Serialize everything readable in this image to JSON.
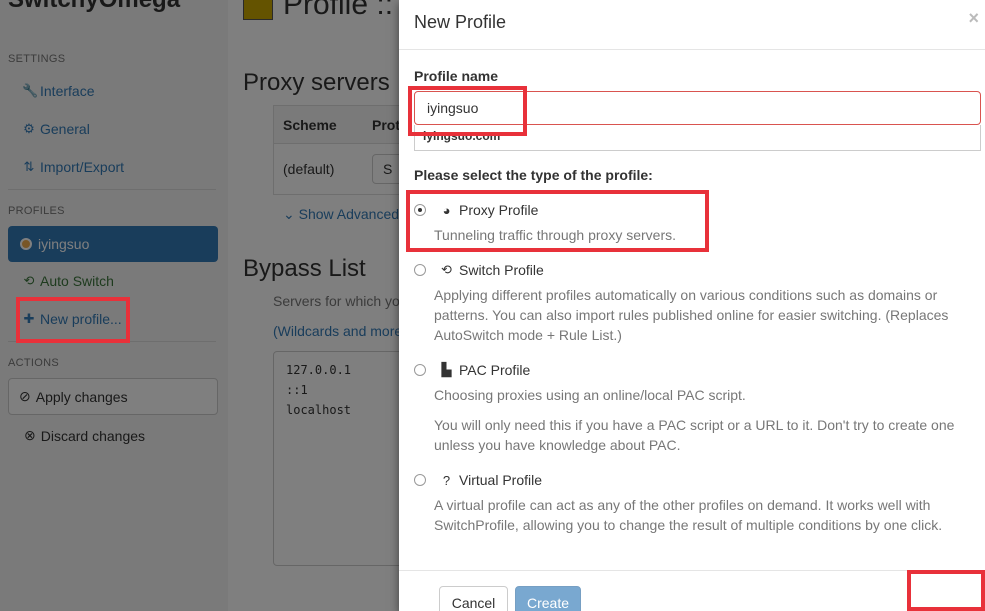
{
  "sidebar": {
    "brand": "SwitchyOmega",
    "settings_header": "SETTINGS",
    "settings_items": [
      {
        "label": "Interface",
        "icon": "wrench-icon"
      },
      {
        "label": "General",
        "icon": "gear-icon"
      },
      {
        "label": "Import/Export",
        "icon": "import-export-icon"
      }
    ],
    "profiles_header": "PROFILES",
    "profiles": [
      {
        "label": "iyingsuo",
        "icon": "globe-icon",
        "active": true
      },
      {
        "label": "Auto Switch",
        "icon": "retweet-icon"
      }
    ],
    "new_profile_label": "New profile...",
    "actions_header": "ACTIONS",
    "apply_label": "Apply changes",
    "discard_label": "Discard changes"
  },
  "main": {
    "profile_title": "Profile ::",
    "proxy_servers_heading": "Proxy servers",
    "table": {
      "headers": [
        "Scheme",
        "Prot"
      ],
      "rows": [
        [
          "(default)",
          "S"
        ]
      ]
    },
    "show_advanced": "Show Advanced",
    "bypass_heading": "Bypass List",
    "bypass_desc": "Servers for which yo",
    "bypass_link": "(Wildcards and more",
    "bypass_lines": "127.0.0.1\n::1\nlocalhost"
  },
  "modal": {
    "title": "New Profile",
    "close": "×",
    "profile_name_label": "Profile name",
    "profile_name_value": "iyingsuo",
    "suggestion": "iyingsuo.com",
    "type_label": "Please select the type of the profile:",
    "types": [
      {
        "name": "Proxy Profile",
        "icon": "globe-icon",
        "checked": true,
        "desc": [
          "Tunneling traffic through proxy servers."
        ]
      },
      {
        "name": "Switch Profile",
        "icon": "retweet-icon",
        "checked": false,
        "desc": [
          "Applying different profiles automatically on various conditions such as domains or patterns. You can also import rules published online for easier switching. (Replaces AutoSwitch mode + Rule List.)"
        ]
      },
      {
        "name": "PAC Profile",
        "icon": "file-icon",
        "checked": false,
        "desc": [
          "Choosing proxies using an online/local PAC script.",
          "You will only need this if you have a PAC script or a URL to it. Don't try to create one unless you have knowledge about PAC."
        ]
      },
      {
        "name": "Virtual Profile",
        "icon": "question-sign-icon",
        "checked": false,
        "desc": [
          "A virtual profile can act as any of the other profiles on demand. It works well with SwitchProfile, allowing you to change the result of multiple conditions by one click."
        ]
      }
    ],
    "cancel_label": "Cancel",
    "create_label": "Create"
  },
  "colors": {
    "primary": "#337ab7",
    "highlight": "#e8313a",
    "profile_swatch": "#c8a600"
  }
}
